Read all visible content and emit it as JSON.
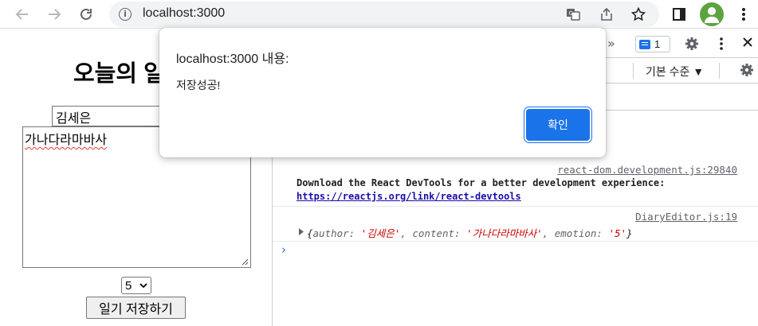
{
  "browser": {
    "url": "localhost:3000"
  },
  "page": {
    "title": "오늘의 일기",
    "author_value": "김세은",
    "content_value": "가나다라마바사",
    "emotion_value": "5",
    "save_label": "일기 저장하기"
  },
  "devtools": {
    "issues_count": "1",
    "level_label": "기본 수준 ▼",
    "messages": [
      {
        "source": "react-dom.development.js:29840",
        "text": "Download the React DevTools for a better development experience: ",
        "link": "https://reactjs.org/link/react-devtools"
      },
      {
        "source": "DiaryEditor.js:19",
        "obj_open": "{",
        "k1": "author: ",
        "v1": "'김세은'",
        "k2": ", content: ",
        "v2": "'가나다라마바사'",
        "k3": ", emotion: ",
        "v3": "'5'",
        "obj_close": "}"
      }
    ]
  },
  "dialog": {
    "title": "localhost:3000 내용:",
    "message": "저장성공!",
    "ok_label": "확인"
  }
}
